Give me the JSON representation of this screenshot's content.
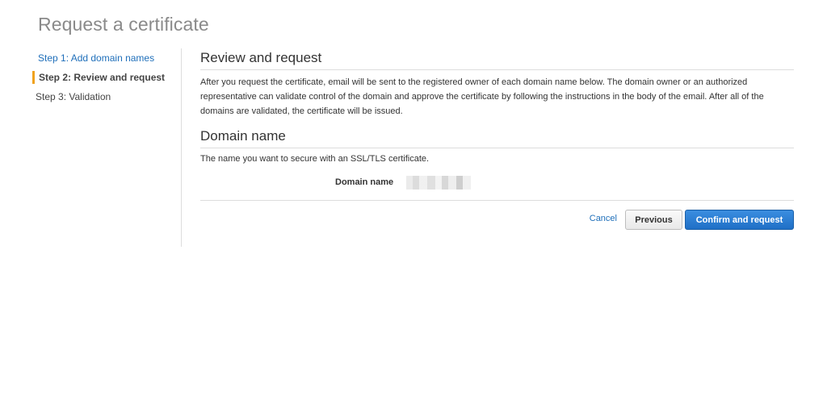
{
  "page": {
    "title": "Request a certificate"
  },
  "steps": [
    {
      "label": "Step 1: Add domain names",
      "state": "link"
    },
    {
      "label": "Step 2: Review and request",
      "state": "current"
    },
    {
      "label": "Step 3: Validation",
      "state": "pending"
    }
  ],
  "review": {
    "heading": "Review and request",
    "description": "After you request the certificate, email will be sent to the registered owner of each domain name below. The domain owner or an authorized representative can validate control of the domain and approve the certificate by following the instructions in the body of the email. After all of the domains are validated, the certificate will be issued."
  },
  "domain_section": {
    "heading": "Domain name",
    "description": "The name you want to secure with an SSL/TLS certificate.",
    "field_label": "Domain name",
    "field_value_redacted": true
  },
  "actions": {
    "cancel_label": "Cancel",
    "previous_label": "Previous",
    "confirm_label": "Confirm and request"
  },
  "colors": {
    "accent_step_marker": "#f0a21e",
    "link": "#1f6fba",
    "primary_button": "#2a7fd4"
  }
}
